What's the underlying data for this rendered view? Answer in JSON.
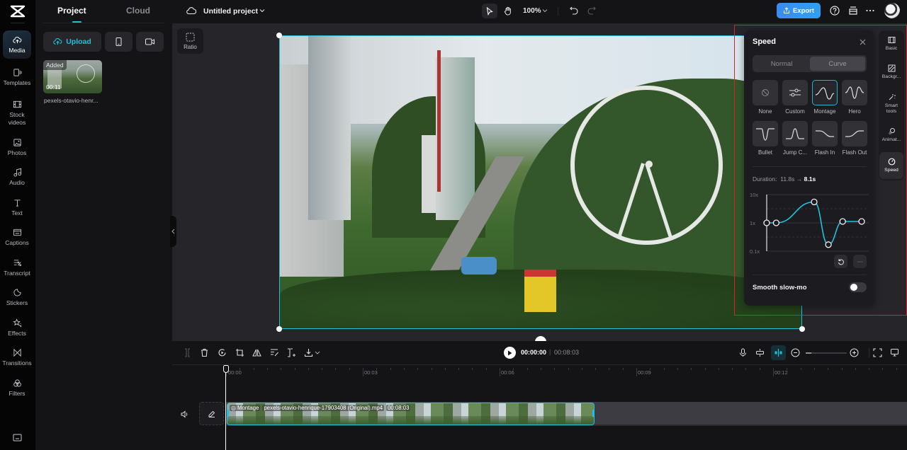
{
  "app": {
    "project_title": "Untitled project",
    "zoom_level": "100%"
  },
  "rail": {
    "items": [
      {
        "label": "Media",
        "icon": "cloud-upload-icon",
        "active": true
      },
      {
        "label": "Templates",
        "icon": "templates-icon"
      },
      {
        "label": "Stock videos",
        "icon": "film-icon"
      },
      {
        "label": "Photos",
        "icon": "image-icon"
      },
      {
        "label": "Audio",
        "icon": "music-icon"
      },
      {
        "label": "Text",
        "icon": "text-icon"
      },
      {
        "label": "Captions",
        "icon": "captions-icon"
      },
      {
        "label": "Transcript",
        "icon": "transcript-icon"
      },
      {
        "label": "Stickers",
        "icon": "sticker-icon"
      },
      {
        "label": "Effects",
        "icon": "effects-icon"
      },
      {
        "label": "Transitions",
        "icon": "transitions-icon"
      },
      {
        "label": "Filters",
        "icon": "filters-icon"
      }
    ]
  },
  "media_panel": {
    "tabs": [
      {
        "label": "Project",
        "active": true
      },
      {
        "label": "Cloud"
      }
    ],
    "upload_label": "Upload",
    "assets": [
      {
        "badge": "Added",
        "duration": "00:11",
        "name": "pexels-otavio-henr..."
      }
    ]
  },
  "topbar": {
    "export_label": "Export"
  },
  "canvas": {
    "ratio_label": "Ratio"
  },
  "speed_panel": {
    "title": "Speed",
    "modes": [
      {
        "label": "Normal"
      },
      {
        "label": "Curve",
        "active": true
      }
    ],
    "presets": [
      {
        "label": "None"
      },
      {
        "label": "Custom"
      },
      {
        "label": "Montage",
        "active": true
      },
      {
        "label": "Hero"
      },
      {
        "label": "Bullet"
      },
      {
        "label": "Jump C..."
      },
      {
        "label": "Flash In"
      },
      {
        "label": "Flash Out"
      }
    ],
    "duration_label": "Duration:",
    "duration_from": "11.8s",
    "duration_arrow": "→",
    "duration_to": "8.1s",
    "curve": {
      "y_labels": [
        "10x",
        "1x",
        "0.1x"
      ],
      "points": [
        {
          "t": 0.0,
          "speed_log": 0.0
        },
        {
          "t": 0.1,
          "speed_log": 0.0
        },
        {
          "t": 0.5,
          "speed_log": 0.74
        },
        {
          "t": 0.65,
          "speed_log": -0.77
        },
        {
          "t": 0.8,
          "speed_log": 0.05
        },
        {
          "t": 1.0,
          "speed_log": 0.05
        }
      ],
      "line_color": "#1fc2de"
    },
    "smooth_label": "Smooth slow-mo",
    "smooth_enabled": false
  },
  "prop_rail": {
    "items": [
      {
        "label": "Basic",
        "icon": "film-icon"
      },
      {
        "label": "Backgr...",
        "icon": "background-icon"
      },
      {
        "label": "Smart tools",
        "icon": "magic-wand-icon"
      },
      {
        "label": "Animat...",
        "icon": "animation-icon"
      },
      {
        "label": "Speed",
        "icon": "speedometer-icon",
        "active": true
      }
    ]
  },
  "timeline": {
    "current_time": "00:00:00",
    "separator": "|",
    "total_time": "00:08:03",
    "ruler_labels": [
      "00:00",
      "00:03",
      "00:06",
      "00:09",
      "00:12"
    ],
    "clip": {
      "effect": "Montage",
      "filename": "pexels-otavio-henrique-17903408 (Original).mp4",
      "duration": "00:08:03"
    }
  },
  "colors": {
    "accent": "#1fc2de",
    "export": "#3a8bef",
    "highlight": "#d9222a"
  }
}
